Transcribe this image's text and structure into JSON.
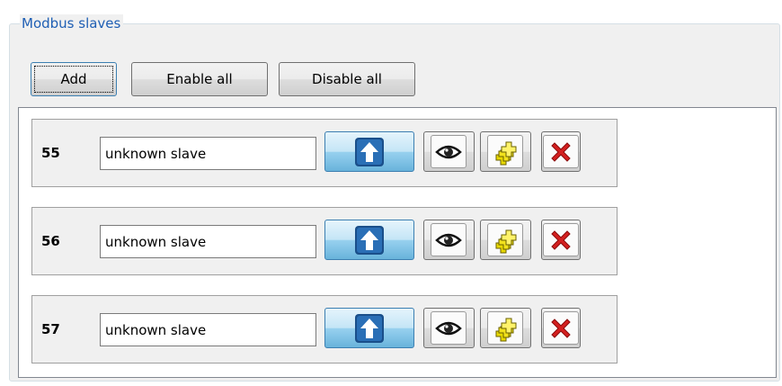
{
  "group": {
    "title": "Modbus slaves"
  },
  "toolbar": {
    "add_label": "Add",
    "enable_all_label": "Enable all",
    "disable_all_label": "Disable all"
  },
  "slaves": [
    {
      "id": "55",
      "name": "unknown slave"
    },
    {
      "id": "56",
      "name": "unknown slave"
    },
    {
      "id": "57",
      "name": "unknown slave"
    }
  ],
  "row_actions": [
    {
      "name": "upload",
      "icon": "up-arrow-icon"
    },
    {
      "name": "view",
      "icon": "eye-icon"
    },
    {
      "name": "duplicate",
      "icon": "copy-plus-icon"
    },
    {
      "name": "delete",
      "icon": "delete-x-icon"
    }
  ],
  "colors": {
    "legend_text": "#1f5fb4",
    "upload_button": "#68b3db",
    "delete_icon": "#d42020",
    "duplicate_icon": "#f2e21c"
  }
}
